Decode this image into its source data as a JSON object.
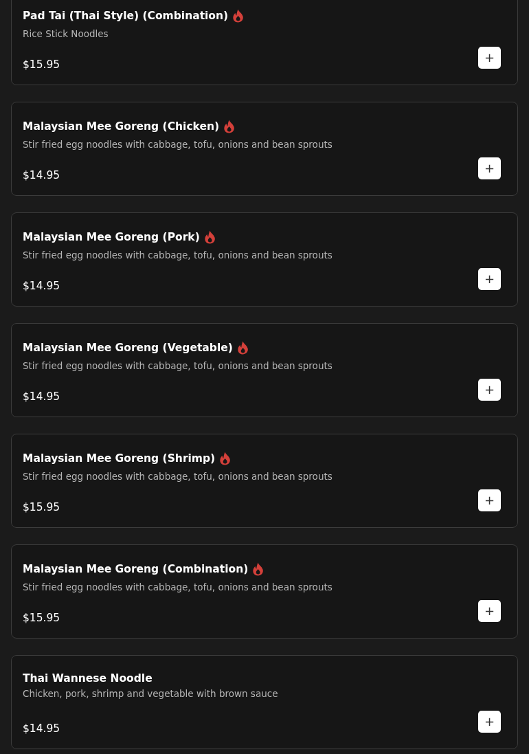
{
  "menu_items": [
    {
      "name": "Pad Tai (Thai Style) (Combination)",
      "spicy": true,
      "description": "Rice Stick Noodles",
      "price": "$15.95",
      "add_label": "+"
    },
    {
      "name": "Malaysian Mee Goreng (Chicken)",
      "spicy": true,
      "description": "Stir fried egg noodles with cabbage, tofu, onions and bean sprouts",
      "price": "$14.95",
      "add_label": "+"
    },
    {
      "name": "Malaysian Mee Goreng (Pork)",
      "spicy": true,
      "description": "Stir fried egg noodles with cabbage, tofu, onions and bean sprouts",
      "price": "$14.95",
      "add_label": "+"
    },
    {
      "name": "Malaysian Mee Goreng (Vegetable)",
      "spicy": true,
      "description": "Stir fried egg noodles with cabbage, tofu, onions and bean sprouts",
      "price": "$14.95",
      "add_label": "+"
    },
    {
      "name": "Malaysian Mee Goreng (Shrimp)",
      "spicy": true,
      "description": "Stir fried egg noodles with cabbage, tofu, onions and bean sprouts",
      "price": "$15.95",
      "add_label": "+"
    },
    {
      "name": "Malaysian Mee Goreng (Combination)",
      "spicy": true,
      "description": "Stir fried egg noodles with cabbage, tofu, onions and bean sprouts",
      "price": "$15.95",
      "add_label": "+"
    },
    {
      "name": "Thai Wannese Noodle",
      "spicy": false,
      "description": "Chicken, pork, shrimp and vegetable with brown sauce",
      "price": "$14.95",
      "add_label": "+"
    }
  ]
}
